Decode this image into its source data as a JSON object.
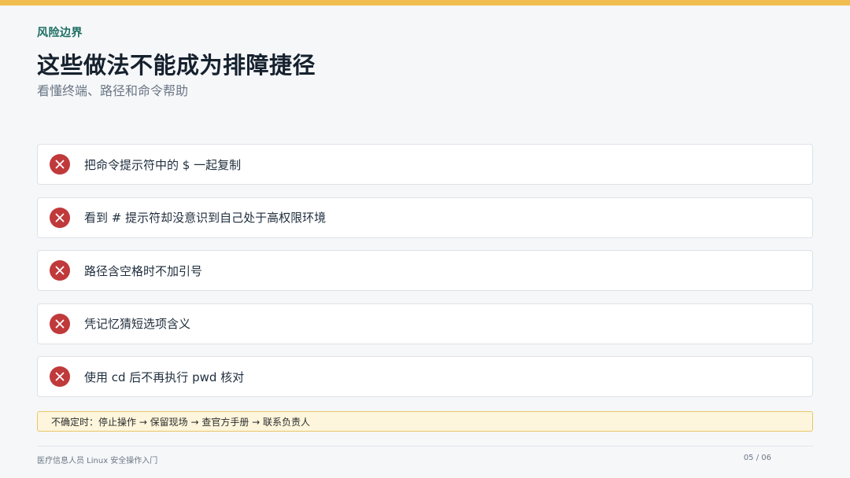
{
  "colors": {
    "accent_bar": "#f0bd4e",
    "eyebrow": "#1b6e63",
    "error_icon": "#c0393b",
    "note_bg": "#fdf6dc",
    "note_border": "#e8c66a"
  },
  "header": {
    "eyebrow": "风险边界",
    "title": "这些做法不能成为排障捷径",
    "subtitle": "看懂终端、路径和命令帮助"
  },
  "items": [
    {
      "icon": "x-circle-icon",
      "text": "把命令提示符中的 $ 一起复制"
    },
    {
      "icon": "x-circle-icon",
      "text": "看到 # 提示符却没意识到自己处于高权限环境"
    },
    {
      "icon": "x-circle-icon",
      "text": "路径含空格时不加引号"
    },
    {
      "icon": "x-circle-icon",
      "text": "凭记忆猜短选项含义"
    },
    {
      "icon": "x-circle-icon",
      "text": "使用 cd 后不再执行 pwd 核对"
    }
  ],
  "note": "不确定时：停止操作 → 保留现场 → 查官方手册 → 联系负责人",
  "footer": {
    "course": "医疗信息人员 Linux 安全操作入门",
    "page": "05 / 06"
  }
}
